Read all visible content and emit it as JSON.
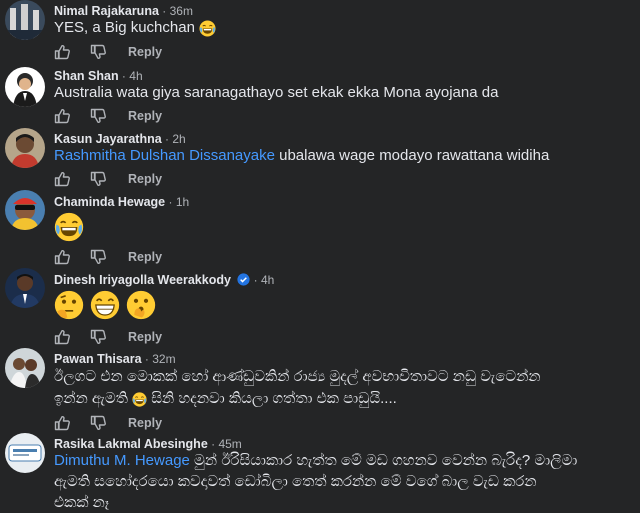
{
  "labels": {
    "reply": "Reply"
  },
  "comments": [
    {
      "author": "Nimal Rajakaruna",
      "time": "36m",
      "text": "YES, a Big kuchchan",
      "emojis_after": [
        "rofl"
      ]
    },
    {
      "author": "Shan Shan",
      "time": "4h",
      "text": "Australia wata giya saranagathayo set ekak ekka Mona ayojana da"
    },
    {
      "author": "Kasun Jayarathna",
      "time": "2h",
      "mention": "Rashmitha Dulshan Dissanayake",
      "text": " ubalawa wage modayo rawattana widiha"
    },
    {
      "author": "Chaminda Hewage",
      "time": "1h",
      "emojis": [
        "tears-of-joy"
      ]
    },
    {
      "author": "Dinesh Iriyagolla Weerakkody",
      "time": "4h",
      "verified": true,
      "emojis": [
        "thinking",
        "grinning",
        "hushed"
      ]
    },
    {
      "author": "Pawan Thisara",
      "time": "32m",
      "line1": "ඊලගට එන මොකක් හෝ ආණ්ඩුවකින් රාජ්‍ය මුදල් අවභාවිතාවට නඩු වැටෙන්න",
      "line2_a": "ඉන්න ඇමති",
      "line2_b": " සිනි හදනවා කියලා ගත්තා එක පාඩුයි....",
      "emoji_inline": "tears-of-joy"
    },
    {
      "author": "Rasika Lakmal Abesinghe",
      "time": "45m",
      "mention": "Dimuthu M. Hewage",
      "line1": " මුන් ඊරිසියාකාර හැත්ත මේ මඩ ගහනව වෙන්න බැරිද? මාලිමා",
      "line2": "ඇමති සහෝදරයො කවදාවත් ඩෝබිලා තෙත් කරන්න මේ වගේ බාල වැඩ කරන",
      "line3": "එකක් නෑ"
    }
  ],
  "colors": {
    "background": "#242526",
    "text": "#e4e6eb",
    "meta": "#b0b3b8",
    "mention": "#4599ff",
    "verified": "#2374e1"
  }
}
